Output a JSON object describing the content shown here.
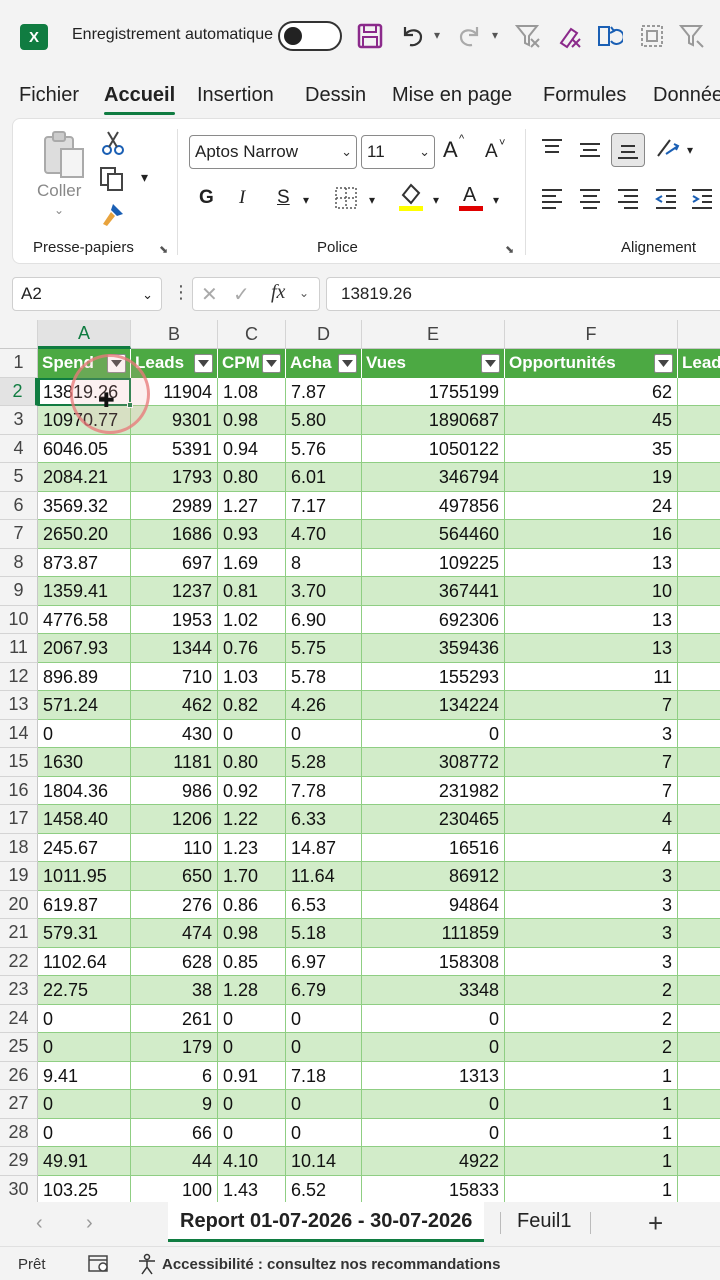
{
  "titlebar": {
    "app_icon": "X",
    "autosave_label": "Enregistrement automatique",
    "autosave_state": "off",
    "icons": [
      "save-icon",
      "undo-icon",
      "redo-icon",
      "clear-filter-icon",
      "clear-format-icon",
      "refresh-icon",
      "select-all-icon",
      "sort-filter-icon"
    ]
  },
  "menu": {
    "tabs": [
      "Fichier",
      "Accueil",
      "Insertion",
      "Dessin",
      "Mise en page",
      "Formules",
      "Données"
    ],
    "active": "Accueil"
  },
  "ribbon": {
    "clipboard": {
      "paste_label": "Coller",
      "group_label": "Presse-papiers"
    },
    "font": {
      "family": "Aptos Narrow",
      "size": "11",
      "bold": "G",
      "italic": "I",
      "underline": "S",
      "group_label": "Police",
      "increase": "A",
      "decrease": "A",
      "fill_color": "#ffff00",
      "font_color": "#e00000"
    },
    "alignment": {
      "group_label": "Alignement"
    }
  },
  "formula_bar": {
    "name_box": "A2",
    "fx_label": "fx",
    "value": "13819.26"
  },
  "grid": {
    "columns": [
      "A",
      "B",
      "C",
      "D",
      "E",
      "F"
    ],
    "selected_column": "A",
    "selected_row": "2",
    "headers": [
      "Spend",
      "Leads",
      "CPM",
      "Acha",
      "Vues",
      "Opportunités",
      "Lead"
    ],
    "rows": [
      [
        "13819.26",
        "11904",
        "1.08",
        "7.87",
        "1755199",
        "62"
      ],
      [
        "10970.77",
        "9301",
        "0.98",
        "5.80",
        "1890687",
        "45"
      ],
      [
        "6046.05",
        "5391",
        "0.94",
        "5.76",
        "1050122",
        "35"
      ],
      [
        "2084.21",
        "1793",
        "0.80",
        "6.01",
        "346794",
        "19"
      ],
      [
        "3569.32",
        "2989",
        "1.27",
        "7.17",
        "497856",
        "24"
      ],
      [
        "2650.20",
        "1686",
        "0.93",
        "4.70",
        "564460",
        "16"
      ],
      [
        "873.87",
        "697",
        "1.69",
        "8",
        "109225",
        "13"
      ],
      [
        "1359.41",
        "1237",
        "0.81",
        "3.70",
        "367441",
        "10"
      ],
      [
        "4776.58",
        "1953",
        "1.02",
        "6.90",
        "692306",
        "13"
      ],
      [
        "2067.93",
        "1344",
        "0.76",
        "5.75",
        "359436",
        "13"
      ],
      [
        "896.89",
        "710",
        "1.03",
        "5.78",
        "155293",
        "11"
      ],
      [
        "571.24",
        "462",
        "0.82",
        "4.26",
        "134224",
        "7"
      ],
      [
        "0",
        "430",
        "0",
        "0",
        "0",
        "3"
      ],
      [
        "1630",
        "1181",
        "0.80",
        "5.28",
        "308772",
        "7"
      ],
      [
        "1804.36",
        "986",
        "0.92",
        "7.78",
        "231982",
        "7"
      ],
      [
        "1458.40",
        "1206",
        "1.22",
        "6.33",
        "230465",
        "4"
      ],
      [
        "245.67",
        "110",
        "1.23",
        "14.87",
        "16516",
        "4"
      ],
      [
        "1011.95",
        "650",
        "1.70",
        "11.64",
        "86912",
        "3"
      ],
      [
        "619.87",
        "276",
        "0.86",
        "6.53",
        "94864",
        "3"
      ],
      [
        "579.31",
        "474",
        "0.98",
        "5.18",
        "111859",
        "3"
      ],
      [
        "1102.64",
        "628",
        "0.85",
        "6.97",
        "158308",
        "3"
      ],
      [
        "22.75",
        "38",
        "1.28",
        "6.79",
        "3348",
        "2"
      ],
      [
        "0",
        "261",
        "0",
        "0",
        "0",
        "2"
      ],
      [
        "0",
        "179",
        "0",
        "0",
        "0",
        "2"
      ],
      [
        "9.41",
        "6",
        "0.91",
        "7.18",
        "1313",
        "1"
      ],
      [
        "0",
        "9",
        "0",
        "0",
        "0",
        "1"
      ],
      [
        "0",
        "66",
        "0",
        "0",
        "0",
        "1"
      ],
      [
        "49.91",
        "44",
        "4.10",
        "10.14",
        "4922",
        "1"
      ],
      [
        "103.25",
        "100",
        "1.43",
        "6.52",
        "15833",
        "1"
      ]
    ],
    "table_header_color": "#4ca943",
    "band_color": "#d2ecc9"
  },
  "sheets": {
    "tabs": [
      "Report 01-07-2026 - 30-07-2026",
      "Feuil1"
    ],
    "active": "Report 01-07-2026 - 30-07-2026",
    "add": "+"
  },
  "status": {
    "ready": "Prêt",
    "accessibility": "Accessibilité : consultez nos recommandations"
  }
}
